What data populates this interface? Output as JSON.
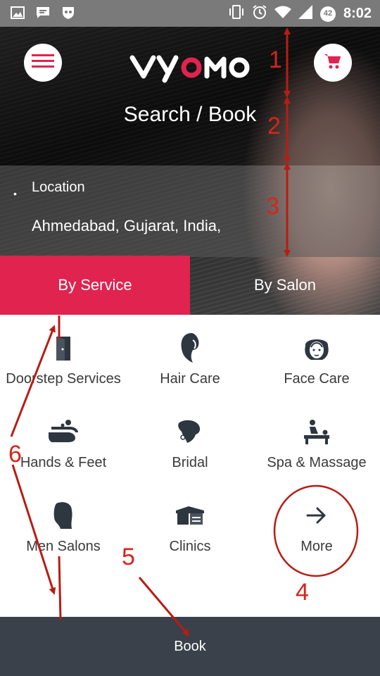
{
  "status_bar": {
    "time": "8:02",
    "battery": "42"
  },
  "header": {
    "logo_text": "vyomo",
    "title": "Search / Book"
  },
  "location": {
    "label": "Location",
    "value": "Ahmedabad, Gujarat, India,"
  },
  "tabs": [
    {
      "label": "By Service",
      "active": true
    },
    {
      "label": "By Salon",
      "active": false
    }
  ],
  "categories": [
    {
      "label": "Doorstep Services",
      "icon": "door-icon"
    },
    {
      "label": "Hair Care",
      "icon": "hair-profile-icon"
    },
    {
      "label": "Face Care",
      "icon": "face-icon"
    },
    {
      "label": "Hands & Feet",
      "icon": "hands-icon"
    },
    {
      "label": "Bridal",
      "icon": "bridal-icon"
    },
    {
      "label": "Spa & Massage",
      "icon": "massage-icon"
    },
    {
      "label": "Men Salons",
      "icon": "man-head-icon"
    },
    {
      "label": "Clinics",
      "icon": "clinic-icon"
    },
    {
      "label": "More",
      "icon": "arrow-right-icon"
    }
  ],
  "bottom_bar": {
    "label": "Book"
  },
  "annotations": [
    "1",
    "2",
    "3",
    "4",
    "5",
    "6"
  ],
  "colors": {
    "accent": "#e0234f",
    "bottom_bar": "#3a414a",
    "annotation": "#d3261c",
    "icon": "#2e3640"
  }
}
